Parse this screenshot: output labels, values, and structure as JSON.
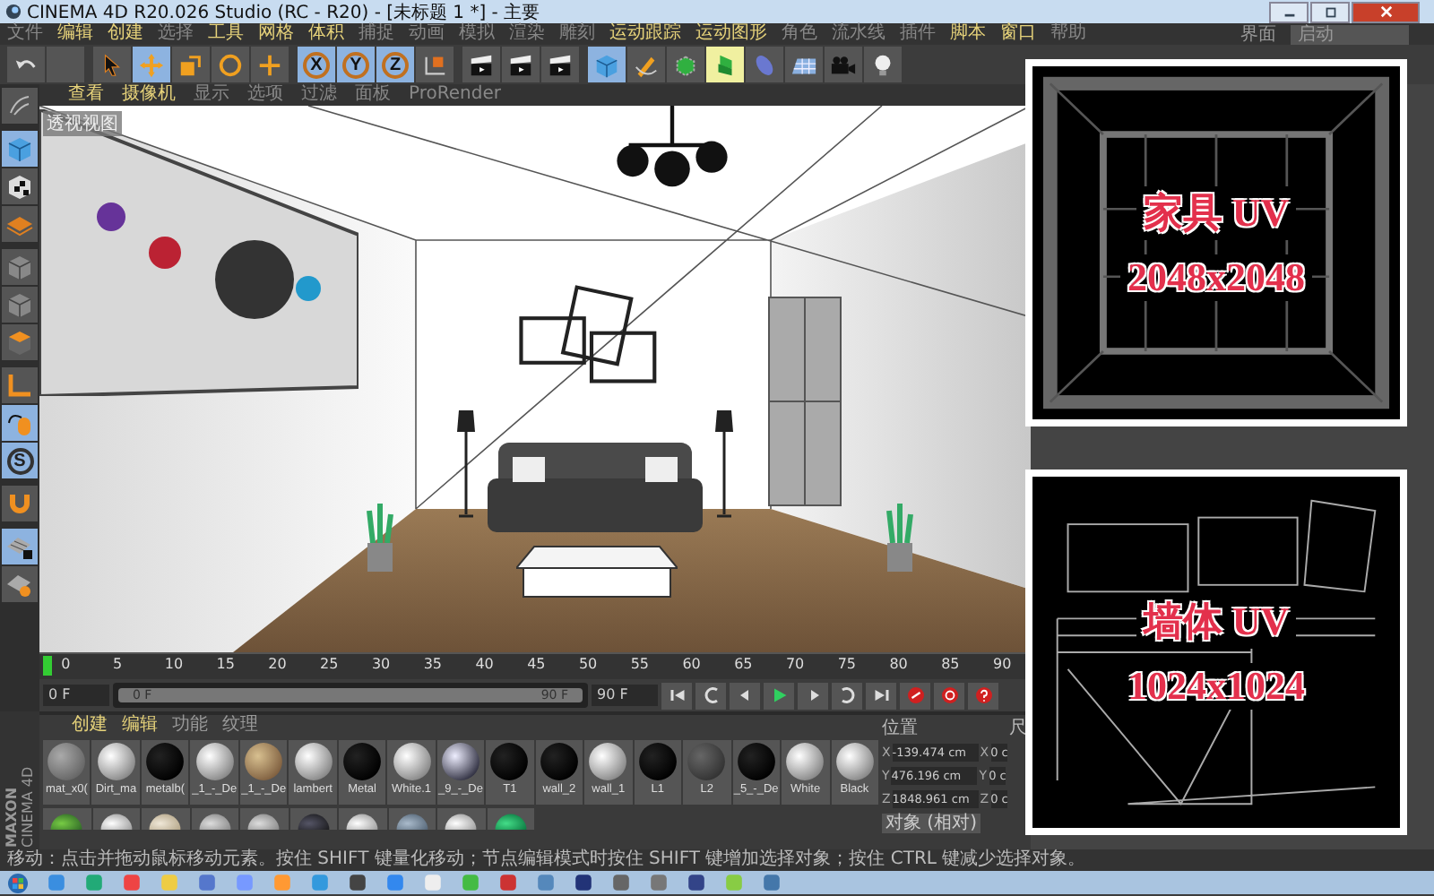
{
  "window": {
    "title": "CINEMA 4D R20.026 Studio (RC - R20) - [未标题 1 *] - 主要"
  },
  "menu": [
    {
      "label": "文件",
      "highlighted": false
    },
    {
      "label": "编辑",
      "highlighted": true
    },
    {
      "label": "创建",
      "highlighted": true
    },
    {
      "label": "选择",
      "highlighted": false
    },
    {
      "label": "工具",
      "highlighted": true
    },
    {
      "label": "网格",
      "highlighted": true
    },
    {
      "label": "体积",
      "highlighted": true
    },
    {
      "label": "捕捉",
      "highlighted": false
    },
    {
      "label": "动画",
      "highlighted": false
    },
    {
      "label": "模拟",
      "highlighted": false
    },
    {
      "label": "渲染",
      "highlighted": false
    },
    {
      "label": "雕刻",
      "highlighted": false
    },
    {
      "label": "运动跟踪",
      "highlighted": true
    },
    {
      "label": "运动图形",
      "highlighted": true
    },
    {
      "label": "角色",
      "highlighted": false
    },
    {
      "label": "流水线",
      "highlighted": false
    },
    {
      "label": "插件",
      "highlighted": false
    },
    {
      "label": "脚本",
      "highlighted": true
    },
    {
      "label": "窗口",
      "highlighted": true
    },
    {
      "label": "帮助",
      "highlighted": false
    }
  ],
  "layout": {
    "label": "界面",
    "value": "启动"
  },
  "toolbar": [
    {
      "items": [
        {
          "kind": "undo",
          "selected": false
        },
        {
          "kind": "blank",
          "selected": false
        }
      ]
    },
    {
      "items": [
        {
          "kind": "cursor",
          "selected": false
        },
        {
          "kind": "move",
          "selected": true
        },
        {
          "kind": "scale",
          "selected": false
        },
        {
          "kind": "rotate",
          "selected": false
        },
        {
          "kind": "axis",
          "selected": false
        }
      ]
    },
    {
      "items": [
        {
          "kind": "letter",
          "label": "X",
          "selected": true
        },
        {
          "kind": "letter",
          "label": "Y",
          "selected": true
        },
        {
          "kind": "letter",
          "label": "Z",
          "selected": true
        },
        {
          "kind": "coord",
          "selected": false
        }
      ]
    },
    {
      "items": [
        {
          "kind": "clapper",
          "selected": false
        },
        {
          "kind": "clapper",
          "selected": false
        },
        {
          "kind": "clapper",
          "selected": false
        }
      ]
    },
    {
      "items": [
        {
          "kind": "cube",
          "selected": true
        },
        {
          "kind": "pen",
          "selected": false
        },
        {
          "kind": "subdiv",
          "selected": false
        },
        {
          "kind": "extrude",
          "selected": true
        },
        {
          "kind": "deform",
          "selected": false
        },
        {
          "kind": "floor",
          "selected": false
        },
        {
          "kind": "camera",
          "selected": false
        },
        {
          "kind": "bulb",
          "selected": false
        }
      ]
    }
  ],
  "left_tools": [
    {
      "items": [
        {
          "kind": "brush",
          "selected": false
        }
      ]
    },
    {
      "items": [
        {
          "kind": "cube",
          "selected": true
        },
        {
          "kind": "checker",
          "selected": false
        },
        {
          "kind": "plane",
          "selected": false
        }
      ]
    },
    {
      "items": [
        {
          "kind": "box",
          "selected": false
        },
        {
          "kind": "box",
          "selected": false
        },
        {
          "kind": "boxorange",
          "selected": false
        }
      ]
    },
    {
      "items": [
        {
          "kind": "axisl",
          "selected": false
        },
        {
          "kind": "mouse",
          "selected": true
        },
        {
          "kind": "letter",
          "label": "S",
          "selected": true
        }
      ]
    },
    {
      "items": [
        {
          "kind": "magnet",
          "selected": false
        }
      ]
    },
    {
      "items": [
        {
          "kind": "gridlock",
          "selected": true
        },
        {
          "kind": "grid",
          "selected": false
        }
      ]
    }
  ],
  "viewport": {
    "menu": [
      {
        "label": "查看",
        "highlighted": true
      },
      {
        "label": "摄像机",
        "highlighted": true
      },
      {
        "label": "显示",
        "highlighted": false
      },
      {
        "label": "选项",
        "highlighted": false
      },
      {
        "label": "过滤",
        "highlighted": false
      },
      {
        "label": "面板",
        "highlighted": false
      },
      {
        "label": "ProRender",
        "highlighted": false
      }
    ],
    "view_label": "透视视图"
  },
  "timeline": {
    "ticks": [
      "0",
      "5",
      "10",
      "15",
      "20",
      "25",
      "30",
      "35",
      "40",
      "45",
      "50",
      "55",
      "60",
      "65",
      "70",
      "75",
      "80",
      "85",
      "90"
    ],
    "level": 0,
    "start": "0 F",
    "range": {
      "start": "0 F",
      "end": "90 F",
      "level": 1
    },
    "end": "90 F"
  },
  "transport": [
    {
      "kind": "first"
    },
    {
      "kind": "prevkey"
    },
    {
      "kind": "prevframe"
    },
    {
      "kind": "play"
    },
    {
      "kind": "nextframe"
    },
    {
      "kind": "nextkey"
    },
    {
      "kind": "last"
    },
    {
      "kind": "record"
    },
    {
      "kind": "autokey"
    },
    {
      "kind": "keyhelp"
    }
  ],
  "brand": [
    "MAXON",
    "CINEMA 4D"
  ],
  "materials": {
    "tabs": [
      {
        "label": "创建",
        "highlighted": true
      },
      {
        "label": "编辑",
        "highlighted": true
      },
      {
        "label": "功能",
        "highlighted": false
      },
      {
        "label": "纹理",
        "highlighted": false
      }
    ],
    "items": [
      {
        "name": "mat_x0(",
        "kind": "fabric"
      },
      {
        "name": "Dirt_ma",
        "kind": "white"
      },
      {
        "name": "metalb(",
        "kind": "black"
      },
      {
        "name": "_1_-_De",
        "kind": "white"
      },
      {
        "name": "_1_-_De",
        "kind": "wood"
      },
      {
        "name": "lambert",
        "kind": "white"
      },
      {
        "name": "Metal",
        "kind": "black"
      },
      {
        "name": "White.1",
        "kind": "white"
      },
      {
        "name": "_9_-_De",
        "kind": "splash"
      },
      {
        "name": "T1",
        "kind": "black"
      },
      {
        "name": "wall_2",
        "kind": "black"
      },
      {
        "name": "wall_1",
        "kind": "white"
      },
      {
        "name": "L1",
        "kind": "black"
      },
      {
        "name": "L2",
        "kind": "mesh"
      },
      {
        "name": "_5_-_De",
        "kind": "black"
      },
      {
        "name": "White",
        "kind": "white"
      },
      {
        "name": "Black",
        "kind": "white"
      }
    ],
    "more_items": [
      {
        "kind": "green"
      },
      {
        "kind": "white"
      },
      {
        "kind": "cream"
      },
      {
        "kind": "grey"
      },
      {
        "kind": "grey"
      },
      {
        "kind": "dark"
      },
      {
        "kind": "white"
      },
      {
        "kind": "bluegrey"
      },
      {
        "kind": "white"
      },
      {
        "kind": "emerald"
      }
    ]
  },
  "coordinates": {
    "title": "位置",
    "title_2": "尺",
    "rows": [
      {
        "axis": "X",
        "value": "-139.474 cm",
        "axis_2": "X",
        "value_2": "0 c"
      },
      {
        "axis": "Y",
        "value": "476.196 cm",
        "axis_2": "Y",
        "value_2": "0 c"
      },
      {
        "axis": "Z",
        "value": "1848.961 cm",
        "axis_2": "Z",
        "value_2": "0 c"
      }
    ],
    "mode": "对象 (相对)"
  },
  "status_bar": "移动：点击并拖动鼠标移动元素。按住 SHIFT 键量化移动；节点编辑模式时按住 SHIFT 键增加选择对象；按住 CTRL 键减少选择对象。",
  "overlays": [
    {
      "kind": "furniture",
      "title": "家具 UV",
      "size": "2048x2048"
    },
    {
      "kind": "wall",
      "title": "墙体 UV",
      "size": "1024x1024"
    }
  ]
}
